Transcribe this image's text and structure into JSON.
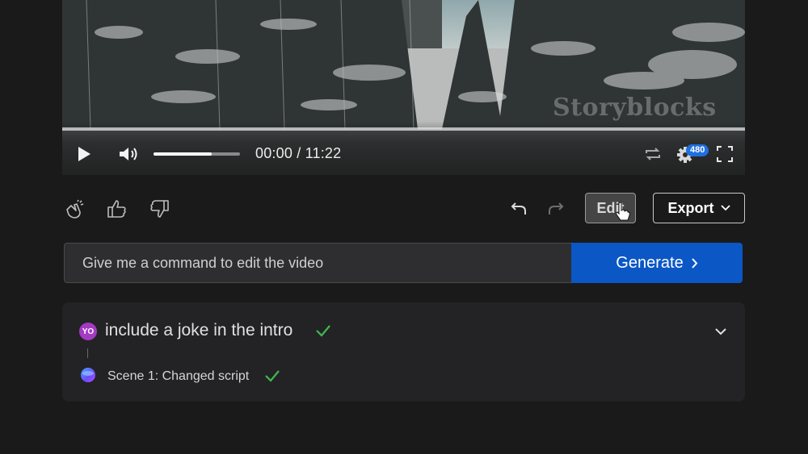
{
  "player": {
    "time": "00:00 / 11:22",
    "quality": "480",
    "watermark": "Storyblocks",
    "volume_level": 0.67,
    "progress": 0.0
  },
  "feedback": {
    "icons": [
      "clap-icon",
      "thumbs-up-icon",
      "thumbs-down-icon"
    ]
  },
  "toolbar": {
    "edit_label": "Edit",
    "export_label": "Export"
  },
  "command": {
    "placeholder": "Give me a command to edit the video",
    "generate_label": "Generate"
  },
  "history": {
    "avatar_initials": "YO",
    "command_text": "include a joke in the intro",
    "step_text": "Scene 1: Changed script"
  },
  "colors": {
    "accent": "#0b57c5",
    "check": "#3fb950",
    "avatar": "#a43ac4"
  }
}
